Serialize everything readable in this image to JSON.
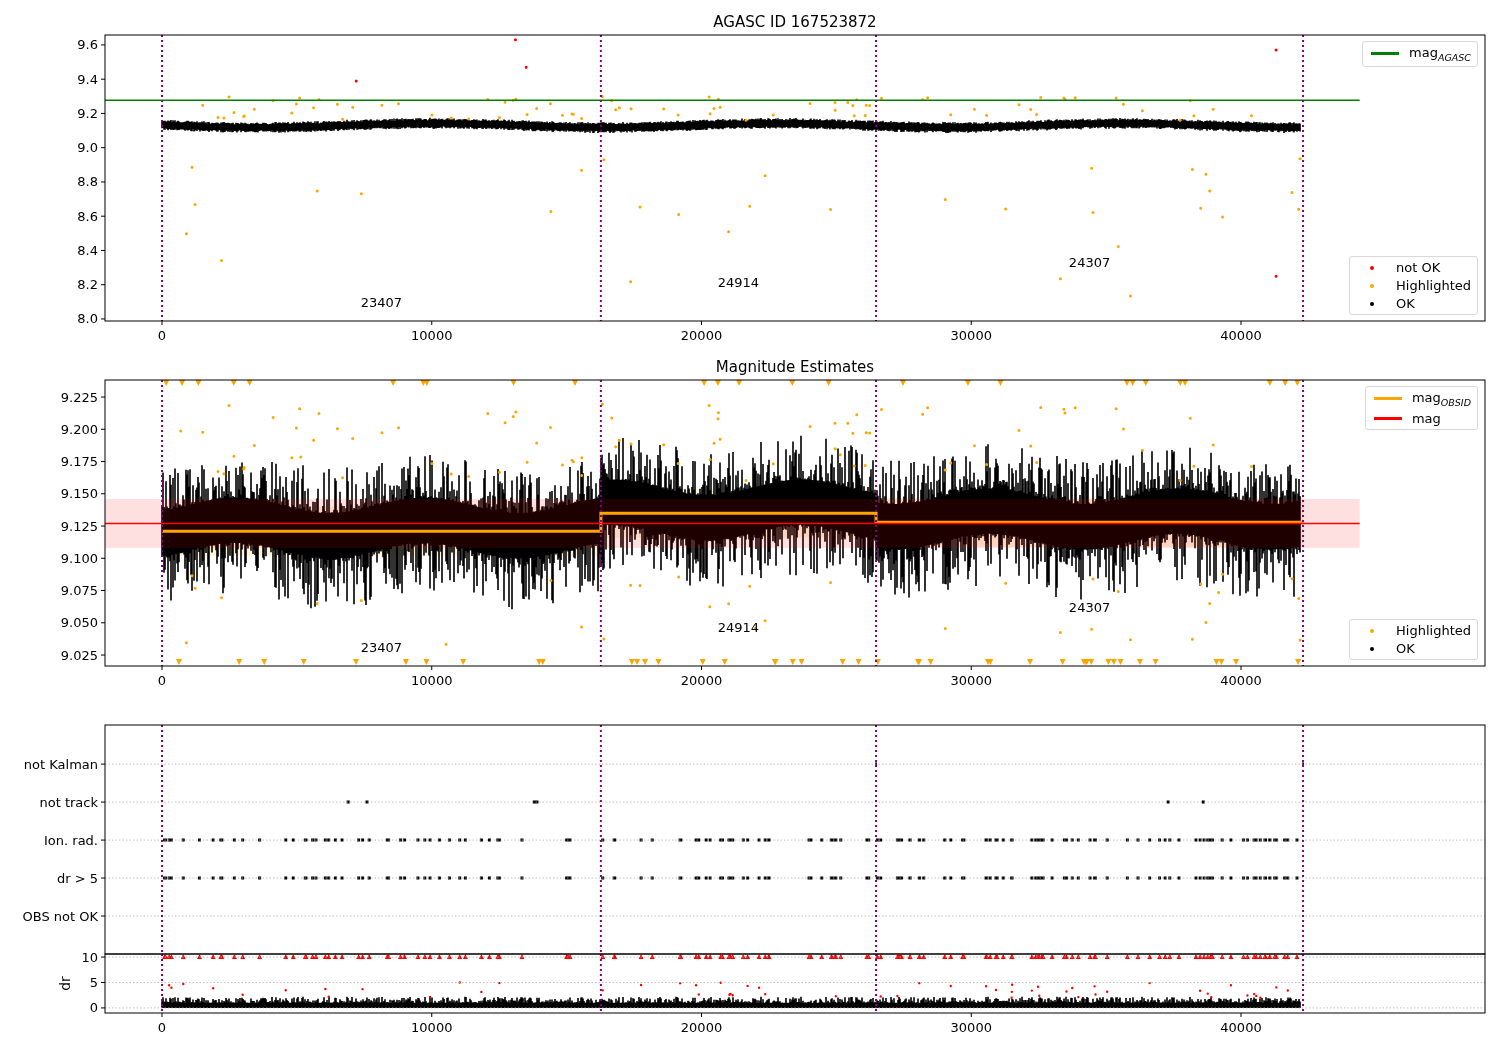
{
  "panels": [
    {
      "kind": "catalog",
      "title": "AGASC ID 167523872",
      "chart_data": {
        "type": "line",
        "xlim": [
          -2113,
          49045
        ],
        "ylim": [
          7.988,
          9.658
        ],
        "xticks": [
          {
            "value": 0,
            "label": "0"
          },
          {
            "value": 10000,
            "label": "10000"
          },
          {
            "value": 20000,
            "label": "20000"
          },
          {
            "value": 30000,
            "label": "30000"
          },
          {
            "value": 40000,
            "label": "40000"
          }
        ],
        "yticks": [
          {
            "value": 8.0,
            "label": "8.0"
          },
          {
            "value": 8.2,
            "label": "8.2"
          },
          {
            "value": 8.4,
            "label": "8.4"
          },
          {
            "value": 8.6,
            "label": "8.6"
          },
          {
            "value": 8.8,
            "label": "8.8"
          },
          {
            "value": 9.0,
            "label": "9.0"
          },
          {
            "value": 9.2,
            "label": "9.2"
          },
          {
            "value": 9.4,
            "label": "9.4"
          },
          {
            "value": 9.6,
            "label": "9.6"
          }
        ],
        "series": [
          {
            "name": "mag$_{AGASC}$",
            "color": "#008000",
            "x": [
              -2113,
              44400
            ],
            "values": [
              9.277,
              9.277
            ]
          }
        ],
        "ref_lines": [
          {
            "axis": "x",
            "value": 0
          },
          {
            "axis": "x",
            "value": 16270
          },
          {
            "axis": "x",
            "value": 26470
          },
          {
            "axis": "x",
            "value": 42300
          }
        ],
        "annotations": [
          "23407",
          "24914",
          "24307"
        ]
      },
      "point_legend": [
        {
          "label": "not OK",
          "color": "#ff0000"
        },
        {
          "label": "Highlighted",
          "color": "#ffa500"
        },
        {
          "label": "OK",
          "color": "#000000"
        }
      ]
    },
    {
      "kind": "estimates",
      "title": "Magnitude Estimates",
      "chart_data": {
        "type": "line",
        "xlim": [
          -2113,
          49045
        ],
        "ylim": [
          9.0165,
          9.2382
        ],
        "xticks": [
          {
            "value": 0,
            "label": "0"
          },
          {
            "value": 10000,
            "label": "10000"
          },
          {
            "value": 20000,
            "label": "20000"
          },
          {
            "value": 30000,
            "label": "30000"
          },
          {
            "value": 40000,
            "label": "40000"
          }
        ],
        "yticks": [
          {
            "value": 9.025,
            "label": "9.025"
          },
          {
            "value": 9.05,
            "label": "9.050"
          },
          {
            "value": 9.075,
            "label": "9.075"
          },
          {
            "value": 9.1,
            "label": "9.100"
          },
          {
            "value": 9.125,
            "label": "9.125"
          },
          {
            "value": 9.15,
            "label": "9.150"
          },
          {
            "value": 9.175,
            "label": "9.175"
          },
          {
            "value": 9.2,
            "label": "9.200"
          },
          {
            "value": 9.225,
            "label": "9.225"
          }
        ],
        "series": [
          {
            "name": "mag$_{OBSID}$",
            "color": "#ffa500",
            "x": [
              0,
              16270,
              16270,
              26470,
              26470,
              42300
            ],
            "values": [
              9.121,
              9.121,
              9.135,
              9.135,
              9.128,
              9.128
            ]
          },
          {
            "name": "mag",
            "color": "#ff0000",
            "x": [
              -2113,
              44400
            ],
            "values": [
              9.127,
              9.127
            ]
          }
        ],
        "bands": [
          {
            "axis": "y",
            "from": 9.108,
            "to": 9.146
          }
        ],
        "ref_lines": [
          {
            "axis": "x",
            "value": 0
          },
          {
            "axis": "x",
            "value": 16270
          },
          {
            "axis": "x",
            "value": 26470
          },
          {
            "axis": "x",
            "value": 42300
          }
        ],
        "annotations": [
          "23407",
          "24914",
          "24307"
        ]
      },
      "point_legend": [
        {
          "label": "Highlighted",
          "color": "#ffa500"
        },
        {
          "label": "OK",
          "color": "#000000"
        }
      ]
    },
    {
      "kind": "flags",
      "chart_data": {
        "type": "scatter",
        "orientation": "horizontal",
        "xlim": [
          -2113,
          49045
        ],
        "categories": [
          "not Kalman",
          "not track",
          "Ion. rad.",
          "dr > 5",
          "OBS not OK"
        ],
        "ref_lines": [
          {
            "axis": "x",
            "value": 0
          },
          {
            "axis": "x",
            "value": 16270
          },
          {
            "axis": "x",
            "value": 26470
          },
          {
            "axis": "x",
            "value": 42300
          }
        ]
      },
      "dr": {
        "chart_data": {
          "type": "scatter",
          "ylabel": "dr",
          "grid": true,
          "xlim": [
            -2113,
            49045
          ],
          "ylim": [
            -1,
            10.6
          ],
          "xticks": [
            {
              "value": 0,
              "label": "0"
            },
            {
              "value": 10000,
              "label": "10000"
            },
            {
              "value": 20000,
              "label": "20000"
            },
            {
              "value": 30000,
              "label": "30000"
            },
            {
              "value": 40000,
              "label": "40000"
            }
          ],
          "yticks": [
            {
              "value": 0,
              "label": "0"
            },
            {
              "value": 5,
              "label": "5"
            },
            {
              "value": 10,
              "label": "10"
            }
          ],
          "ref_lines": [
            {
              "axis": "x",
              "value": 0
            },
            {
              "axis": "x",
              "value": 16270
            },
            {
              "axis": "x",
              "value": 26470
            },
            {
              "axis": "x",
              "value": 42300
            }
          ]
        }
      }
    }
  ]
}
